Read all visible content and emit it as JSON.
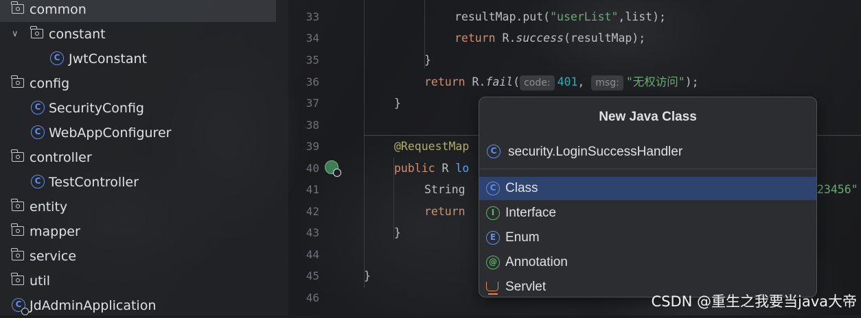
{
  "tree": {
    "items": [
      {
        "label": "common",
        "type": "package"
      },
      {
        "label": "constant",
        "type": "package"
      },
      {
        "label": "JwtConstant",
        "type": "class"
      },
      {
        "label": "config",
        "type": "package"
      },
      {
        "label": "SecurityConfig",
        "type": "class"
      },
      {
        "label": "WebAppConfigurer",
        "type": "class"
      },
      {
        "label": "controller",
        "type": "package"
      },
      {
        "label": "TestController",
        "type": "class"
      },
      {
        "label": "entity",
        "type": "package"
      },
      {
        "label": "mapper",
        "type": "package"
      },
      {
        "label": "service",
        "type": "package"
      },
      {
        "label": "util",
        "type": "package"
      },
      {
        "label": "JdAdminApplication",
        "type": "app-class"
      }
    ],
    "class_icon_letter": "C"
  },
  "editor": {
    "line_numbers": [
      "33",
      "34",
      "35",
      "36",
      "37",
      "38",
      "39",
      "40",
      "41",
      "42",
      "43",
      "44",
      "45",
      "46"
    ],
    "code": {
      "l33_a": "resultMap.put(",
      "l33_str": "\"userList\"",
      "l33_b": ",list);",
      "l34_kw": "return",
      "l34_a": " R.",
      "l34_it": "success",
      "l34_b": "(resultMap);",
      "l35": "}",
      "l36_kw": "return",
      "l36_a": " R.",
      "l36_it": "fail",
      "l36_b": "(",
      "l36_hint1": "code:",
      "l36_num": "401",
      "l36_c": ",",
      "l36_hint2": "msg:",
      "l36_str": "\"无权访问\"",
      "l36_d": ");",
      "l37": "}",
      "l39_ann": "@RequestMap",
      "l40_kw": "public",
      "l40_a": " R ",
      "l40_b": "lo",
      "l41_a": "String",
      "l41_tail": "23456\"",
      "l42_kw": "return",
      "l43": "}",
      "l45": "}"
    }
  },
  "popup": {
    "title": "New Java Class",
    "name_value": "security.LoginSuccessHandler",
    "kinds": [
      {
        "label": "Class",
        "letter": "C",
        "color": "#5f8ef2",
        "selected": true
      },
      {
        "label": "Interface",
        "letter": "I",
        "color": "#5fb865",
        "selected": false
      },
      {
        "label": "Enum",
        "letter": "E",
        "color": "#5f8ef2",
        "selected": false
      },
      {
        "label": "Annotation",
        "letter": "@",
        "color": "#5fb865",
        "selected": false
      },
      {
        "label": "Servlet",
        "letter": "",
        "color": "#e8844a",
        "selected": false
      }
    ]
  },
  "watermark": "CSDN @重生之我要当java大帝"
}
